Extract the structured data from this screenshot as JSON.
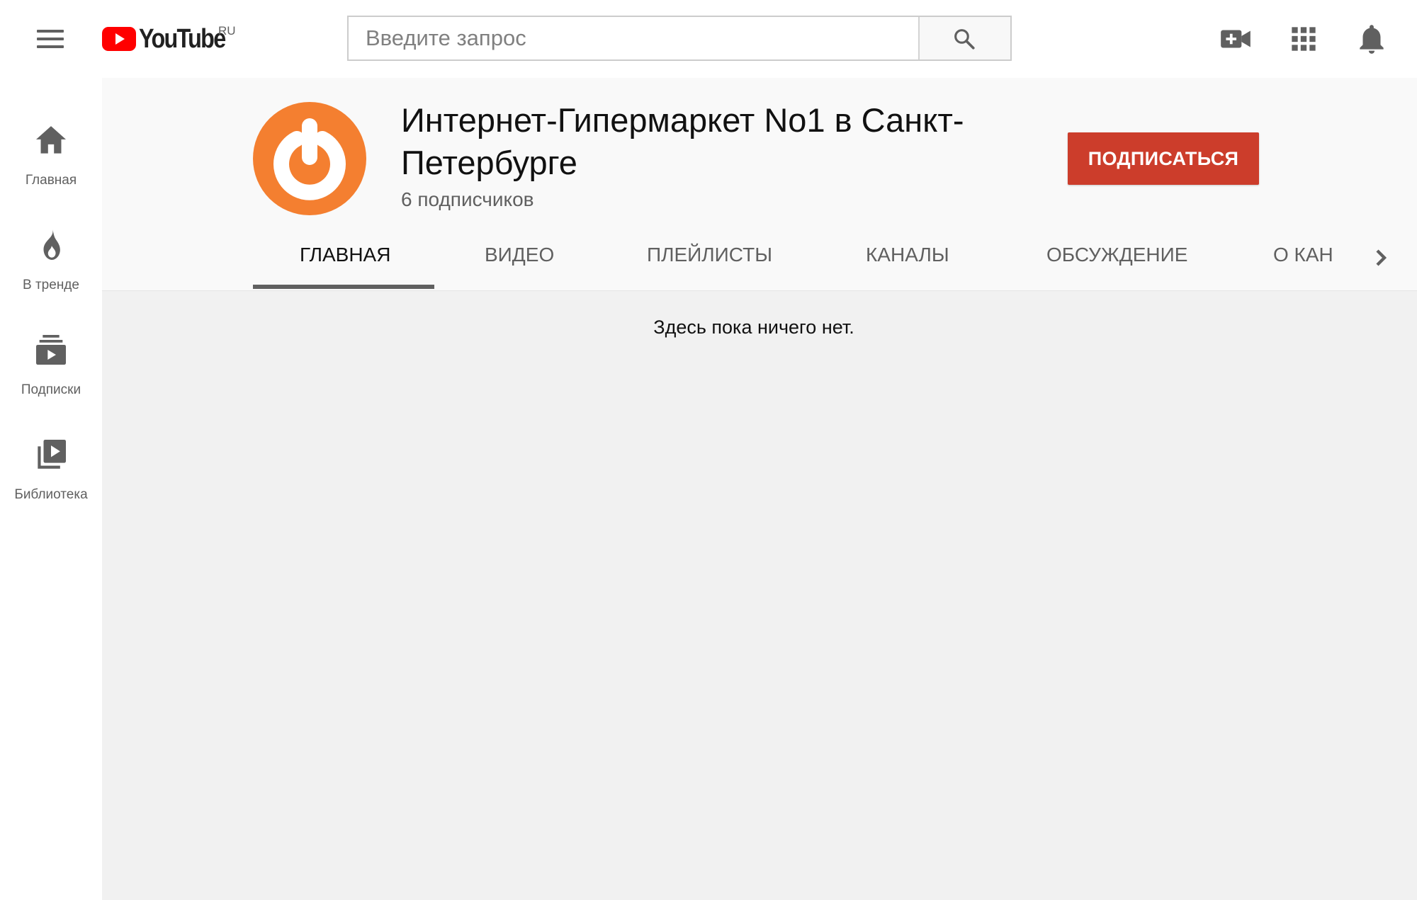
{
  "header": {
    "logo_text": "YouTube",
    "region": "RU",
    "search_placeholder": "Введите запрос"
  },
  "sidebar": {
    "items": [
      {
        "label": "Главная",
        "icon": "home-icon"
      },
      {
        "label": "В тренде",
        "icon": "flame-icon"
      },
      {
        "label": "Подписки",
        "icon": "subscriptions-icon"
      },
      {
        "label": "Библиотека",
        "icon": "library-icon"
      }
    ]
  },
  "channel": {
    "title": "Интернет-Гипермаркет No1 в Санкт-Петербурге",
    "subscribers": "6 подписчиков",
    "subscribe_label": "ПОДПИСАТЬСЯ",
    "avatar_color": "#f47f30"
  },
  "tabs": [
    {
      "label": "ГЛАВНАЯ",
      "active": true
    },
    {
      "label": "ВИДЕО",
      "active": false
    },
    {
      "label": "ПЛЕЙЛИСТЫ",
      "active": false
    },
    {
      "label": "КАНАЛЫ",
      "active": false
    },
    {
      "label": "ОБСУЖДЕНИЕ",
      "active": false
    },
    {
      "label": "О КАН",
      "active": false
    }
  ],
  "content": {
    "empty_message": "Здесь пока ничего нет."
  },
  "colors": {
    "brand_red": "#ff0000",
    "subscribe_red": "#cc3d2b",
    "icon_gray": "#606060"
  }
}
